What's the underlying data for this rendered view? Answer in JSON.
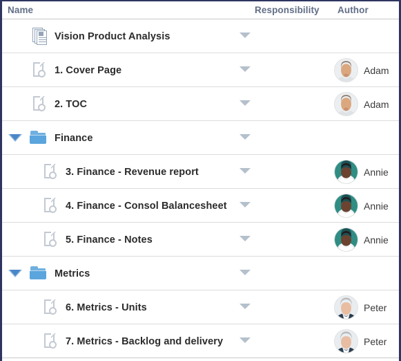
{
  "columns": {
    "name": "Name",
    "responsibility": "Responsibility",
    "author": "Author"
  },
  "colors": {
    "window_border": "#2e3560",
    "header_text": "#616e87",
    "row_separator": "#dcdcdc",
    "folder_blue": "#5aa5dd",
    "twisty_blue": "#4a86c8",
    "dropdown_gray": "#b4c0cb",
    "doc_icon_gray": "#c3c9d2"
  },
  "rows": [
    {
      "id": "vision-product-analysis",
      "label": "Vision Product Analysis",
      "icon": "document-stack-icon",
      "level": 0,
      "twisty": "none",
      "responsibility_control": "dropdown-arrow-icon",
      "author": null
    },
    {
      "id": "cover-page",
      "label": "1. Cover Page",
      "icon": "document-icon",
      "level": 1,
      "twisty": "none",
      "responsibility_control": "dropdown-arrow-icon",
      "author": {
        "name": "Adam",
        "avatar": "avatar-adam"
      }
    },
    {
      "id": "toc",
      "label": "2. TOC",
      "icon": "document-icon",
      "level": 1,
      "twisty": "none",
      "responsibility_control": "dropdown-arrow-icon",
      "author": {
        "name": "Adam",
        "avatar": "avatar-adam"
      }
    },
    {
      "id": "finance",
      "label": "Finance",
      "icon": "folder-icon",
      "level": 1,
      "twisty": "expanded",
      "responsibility_control": "dropdown-arrow-icon",
      "author": null
    },
    {
      "id": "finance-revenue-report",
      "label": "3. Finance - Revenue report",
      "icon": "document-icon",
      "level": 2,
      "twisty": "none",
      "responsibility_control": "dropdown-arrow-icon",
      "author": {
        "name": "Annie",
        "avatar": "avatar-annie"
      }
    },
    {
      "id": "finance-consol-balancesheet",
      "label": "4. Finance - Consol Balancesheet",
      "icon": "document-icon",
      "level": 2,
      "twisty": "none",
      "responsibility_control": "dropdown-arrow-icon",
      "author": {
        "name": "Annie",
        "avatar": "avatar-annie"
      }
    },
    {
      "id": "finance-notes",
      "label": "5. Finance - Notes",
      "icon": "document-icon",
      "level": 2,
      "twisty": "none",
      "responsibility_control": "dropdown-arrow-icon",
      "author": {
        "name": "Annie",
        "avatar": "avatar-annie"
      }
    },
    {
      "id": "metrics",
      "label": "Metrics",
      "icon": "folder-icon",
      "level": 1,
      "twisty": "expanded",
      "responsibility_control": "dropdown-arrow-icon",
      "author": null
    },
    {
      "id": "metrics-units",
      "label": "6. Metrics - Units",
      "icon": "document-icon",
      "level": 2,
      "twisty": "none",
      "responsibility_control": "dropdown-arrow-icon",
      "author": {
        "name": "Peter",
        "avatar": "avatar-peter"
      }
    },
    {
      "id": "metrics-backlog-and-delivery",
      "label": "7. Metrics - Backlog and delivery",
      "icon": "document-icon",
      "level": 2,
      "twisty": "none",
      "responsibility_control": "dropdown-arrow-icon",
      "author": {
        "name": "Peter",
        "avatar": "avatar-peter"
      }
    }
  ]
}
